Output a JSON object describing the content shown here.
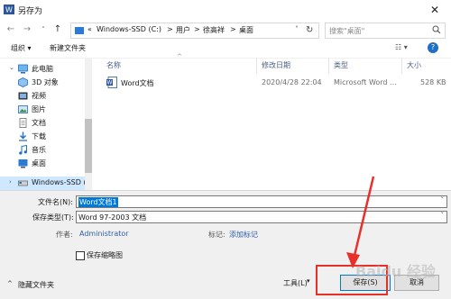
{
  "window": {
    "title": "另存为",
    "close_glyph": "✕"
  },
  "nav": {
    "back_glyph": "←",
    "forward_glyph": "→",
    "up_glyph": "↑",
    "breadcrumb": [
      "«",
      "Windows-SSD (C:)",
      ">",
      "用户",
      ">",
      "徐高祥",
      ">",
      "桌面"
    ],
    "dropdown_glyph": "˅",
    "refresh_glyph": "↻",
    "search_placeholder": "搜索\"桌面\""
  },
  "command_bar": {
    "organize": "组织 ▾",
    "new_folder": "新建文件夹",
    "view_glyph": "☷ ▾",
    "help_glyph": "?"
  },
  "sidebar": {
    "items": [
      {
        "label": "此电脑",
        "icon": "computer-icon"
      },
      {
        "label": "3D 对象",
        "icon": "3d-objects-icon"
      },
      {
        "label": "视频",
        "icon": "video-icon"
      },
      {
        "label": "图片",
        "icon": "pictures-icon"
      },
      {
        "label": "文档",
        "icon": "documents-icon"
      },
      {
        "label": "下载",
        "icon": "downloads-icon"
      },
      {
        "label": "音乐",
        "icon": "music-icon"
      },
      {
        "label": "桌面",
        "icon": "desktop-icon"
      },
      {
        "label": "Windows-SSD (",
        "icon": "drive-icon"
      }
    ]
  },
  "file_list": {
    "columns": [
      "名称",
      "修改日期",
      "类型",
      "大小"
    ],
    "rows": [
      {
        "name": "Word文档",
        "modified": "2020/4/28 22:04",
        "type": "Microsoft Word ...",
        "size": "528 KB"
      }
    ]
  },
  "form": {
    "filename_label": "文件名(N):",
    "filename_value": "Word文档1",
    "filetype_label": "保存类型(T):",
    "filetype_value": "Word 97-2003 文档",
    "author_label": "作者:",
    "author_value": "Administrator",
    "tags_label": "标记:",
    "tags_value": "添加标记",
    "thumbnail_label": "保存缩略图",
    "hide_folders": "隐藏文件夹",
    "tools": "工具(L)",
    "save": "保存(S)",
    "cancel": "取消"
  },
  "colors": {
    "accent": "#0078d7",
    "selection": "#cde8ff",
    "annotation": "#e8302a",
    "link": "#2e5ea8"
  },
  "watermark": "Baidu 经验"
}
